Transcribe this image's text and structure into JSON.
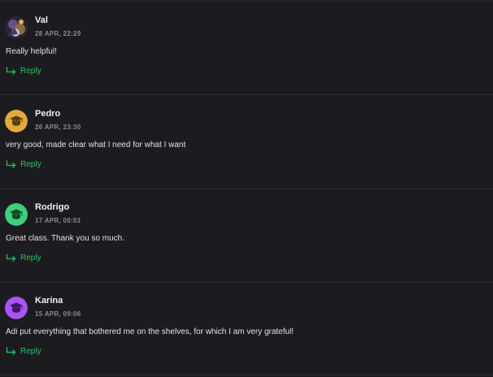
{
  "accent_color": "#22c55e",
  "reply_label": "Reply",
  "comments": [
    {
      "author": "Val",
      "date": "28 APR, 22:29",
      "text": "Really helpful!",
      "avatar": {
        "type": "photo",
        "color": "#3a2f4a"
      }
    },
    {
      "author": "Pedro",
      "date": "26 APR, 23:30",
      "text": "very good, made clear what I need for what I want",
      "avatar": {
        "type": "graduation-cap-icon",
        "color": "#e3a93a"
      }
    },
    {
      "author": "Rodrigo",
      "date": "17 APR, 00:01",
      "text": "Great class. Thank you so much.",
      "avatar": {
        "type": "graduation-cap-icon",
        "color": "#3fcf7c"
      }
    },
    {
      "author": "Karina",
      "date": "15 APR, 09:06",
      "text": "Adi put everything that bothered me on the shelves, for which I am very grateful!",
      "avatar": {
        "type": "graduation-cap-icon",
        "color": "#a855f7"
      }
    }
  ]
}
